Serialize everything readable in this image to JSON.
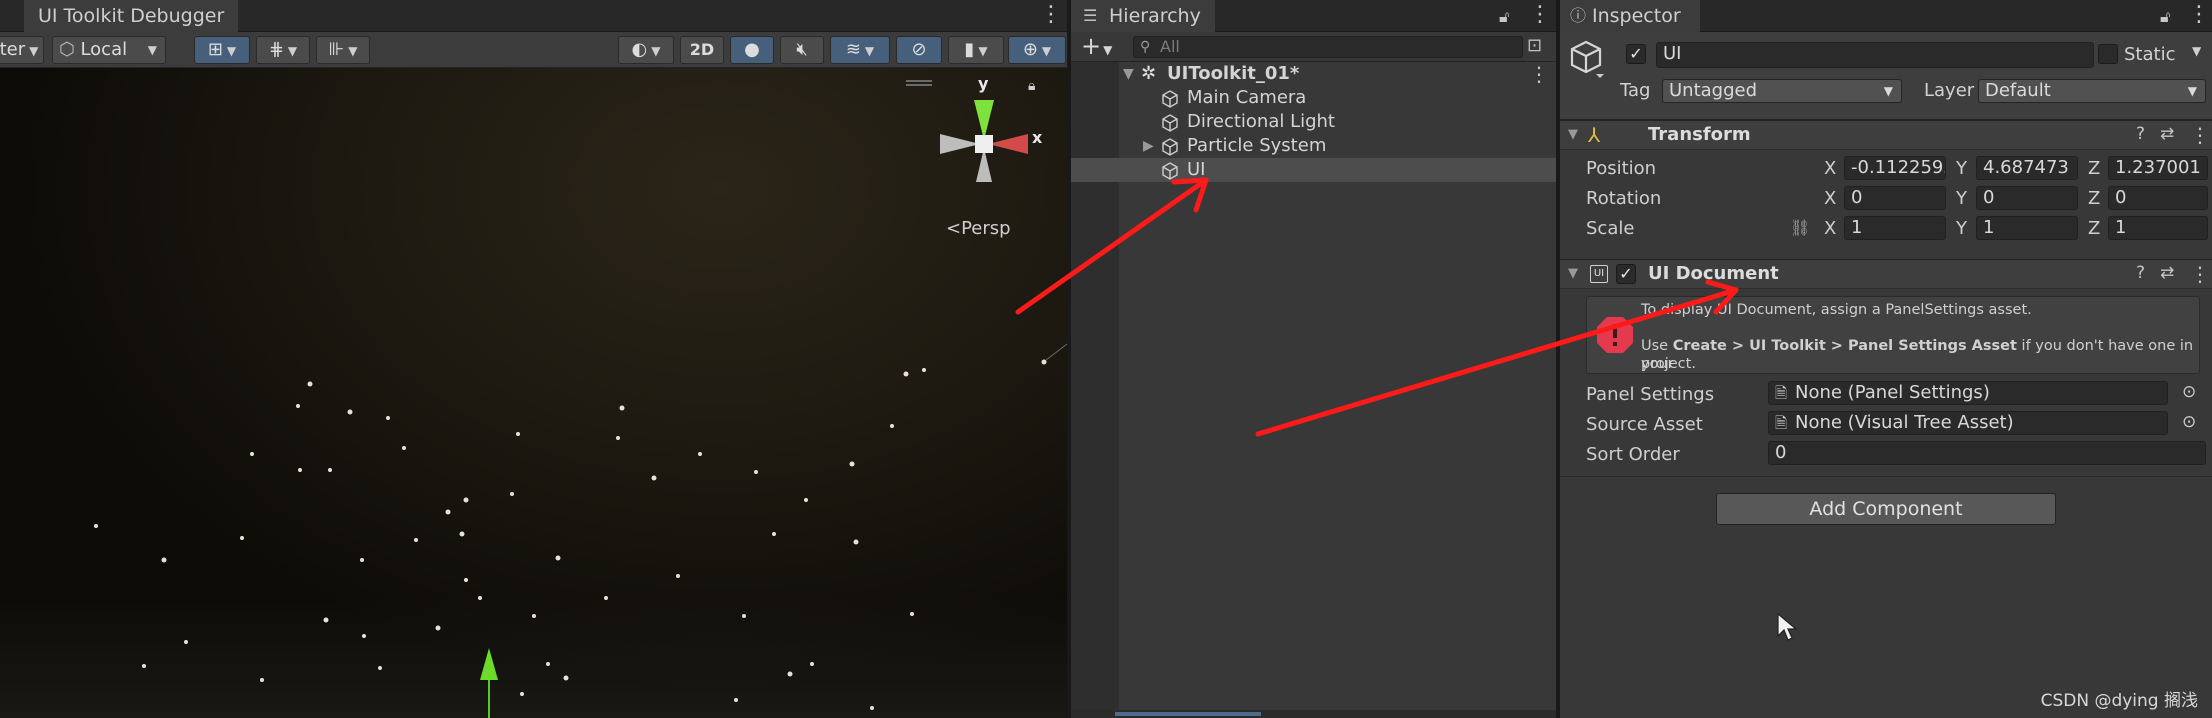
{
  "scene": {
    "tab_label": "UI Toolkit Debugger",
    "pivot_partial": "ter",
    "space_label": "Local",
    "twod_label": "2D",
    "gizmo": {
      "y_label": "y",
      "x_label": "x",
      "persp_label": "Persp"
    }
  },
  "hierarchy": {
    "tab_label": "Hierarchy",
    "search_placeholder": "All",
    "items": [
      {
        "label": "UIToolkit_01*",
        "icon": "unity-scene-icon"
      },
      {
        "label": "Main Camera",
        "icon": "cube-icon"
      },
      {
        "label": "Directional Light",
        "icon": "cube-icon"
      },
      {
        "label": "Particle System",
        "icon": "cube-icon"
      },
      {
        "label": "UI",
        "icon": "cube-icon"
      }
    ]
  },
  "inspector": {
    "tab_label": "Inspector",
    "object_name": "UI",
    "static_label": "Static",
    "tag_label": "Tag",
    "tag_value": "Untagged",
    "layer_label": "Layer",
    "layer_value": "Default",
    "transform": {
      "title": "Transform",
      "position_label": "Position",
      "rotation_label": "Rotation",
      "scale_label": "Scale",
      "axes": {
        "x": "X",
        "y": "Y",
        "z": "Z"
      },
      "position": {
        "x": "-0.1122595",
        "y": "4.687473",
        "z": "1.237001"
      },
      "rotation": {
        "x": "0",
        "y": "0",
        "z": "0"
      },
      "scale": {
        "x": "1",
        "y": "1",
        "z": "1"
      }
    },
    "ui_document": {
      "title": "UI Document",
      "help_line1": "To display UI Document, assign a PanelSettings asset.",
      "help_line2_pre": "Use ",
      "help_line2_bold": "Create > UI Toolkit > Panel Settings Asset",
      "help_line2_post": " if you don't have one in your",
      "help_line3": "project.",
      "panel_settings_label": "Panel Settings",
      "panel_settings_value": "None (Panel Settings)",
      "source_asset_label": "Source Asset",
      "source_asset_value": "None (Visual Tree Asset)",
      "sort_order_label": "Sort Order",
      "sort_order_value": "0"
    },
    "add_component_label": "Add Component"
  },
  "watermark": "CSDN @dying 搁浅",
  "colors": {
    "arrow": "#ff1a1a",
    "selection": "#4d4d4d",
    "active_tool": "#46607c"
  }
}
